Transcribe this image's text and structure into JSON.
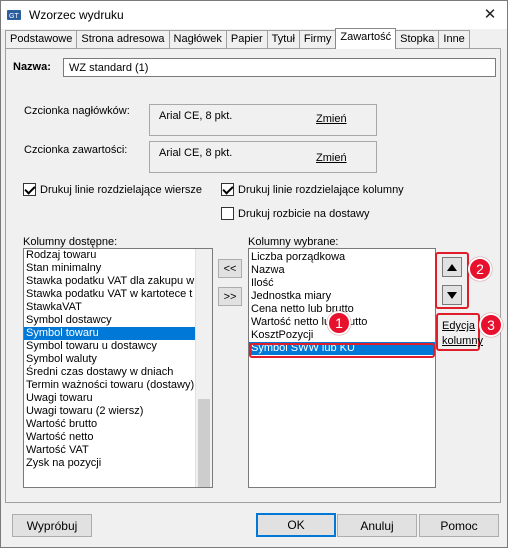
{
  "window": {
    "title": "Wzorzec wydruku",
    "close_label": "✕"
  },
  "tabs": [
    {
      "label": "Podstawowe"
    },
    {
      "label": "Strona adresowa"
    },
    {
      "label": "Nagłówek"
    },
    {
      "label": "Papier"
    },
    {
      "label": "Tytuł"
    },
    {
      "label": "Firmy"
    },
    {
      "label": "Zawartość",
      "active": true
    },
    {
      "label": "Stopka"
    },
    {
      "label": "Inne"
    }
  ],
  "form": {
    "name_label": "Nazwa:",
    "name_value": "WZ standard (1)",
    "header_font_label": "Czcionka nagłówków:",
    "header_font_value": "Arial CE, 8 pkt.",
    "header_font_change": "Zmień",
    "content_font_label": "Czcionka zawartości:",
    "content_font_value": "Arial CE, 8 pkt.",
    "content_font_change": "Zmień",
    "cb_row_lines": "Drukuj linie rozdzielające wiersze",
    "cb_col_lines": "Drukuj linie rozdzielające kolumny",
    "cb_split_deliveries": "Drukuj rozbicie na dostawy",
    "available_label": "Kolumny dostępne:",
    "selected_label": "Kolumny wybrane:",
    "add_button": ">>",
    "remove_button": "<<",
    "edit_column_link": "Edycja kolumny"
  },
  "available_columns": [
    "Rodzaj towaru",
    "Stan minimalny",
    "Stawka podatku VAT dla zakupu w",
    "Stawka podatku VAT w kartotece t",
    "StawkaVAT",
    "Symbol dostawcy",
    "Symbol towaru",
    "Symbol towaru u dostawcy",
    "Symbol waluty",
    "Średni czas dostawy w dniach",
    "Termin ważności towaru (dostawy)",
    "Uwagi towaru",
    "Uwagi towaru (2 wiersz)",
    "Wartość brutto",
    "Wartość netto",
    "Wartość VAT",
    "Zysk na pozycji"
  ],
  "available_selected_index": 6,
  "selected_columns": [
    "Liczba porządkowa",
    "Nazwa",
    "Ilość",
    "Jednostka miary",
    "Cena netto lub brutto",
    "Wartość netto lub brutto",
    "KosztPozycji",
    "Symbol SWW lub KU"
  ],
  "selected_selected_index": 7,
  "callouts": [
    "1",
    "2",
    "3"
  ],
  "footer": {
    "preview": "Wypróbuj",
    "ok": "OK",
    "cancel": "Anuluj",
    "help": "Pomoc"
  },
  "icons": {
    "app": "printer-template-icon",
    "close": "close-icon",
    "up": "triangle-up-icon",
    "down": "triangle-down-icon"
  },
  "colors": {
    "selection": "#0078d7",
    "callout": "#e8112d",
    "default_button": "#0078d7"
  }
}
